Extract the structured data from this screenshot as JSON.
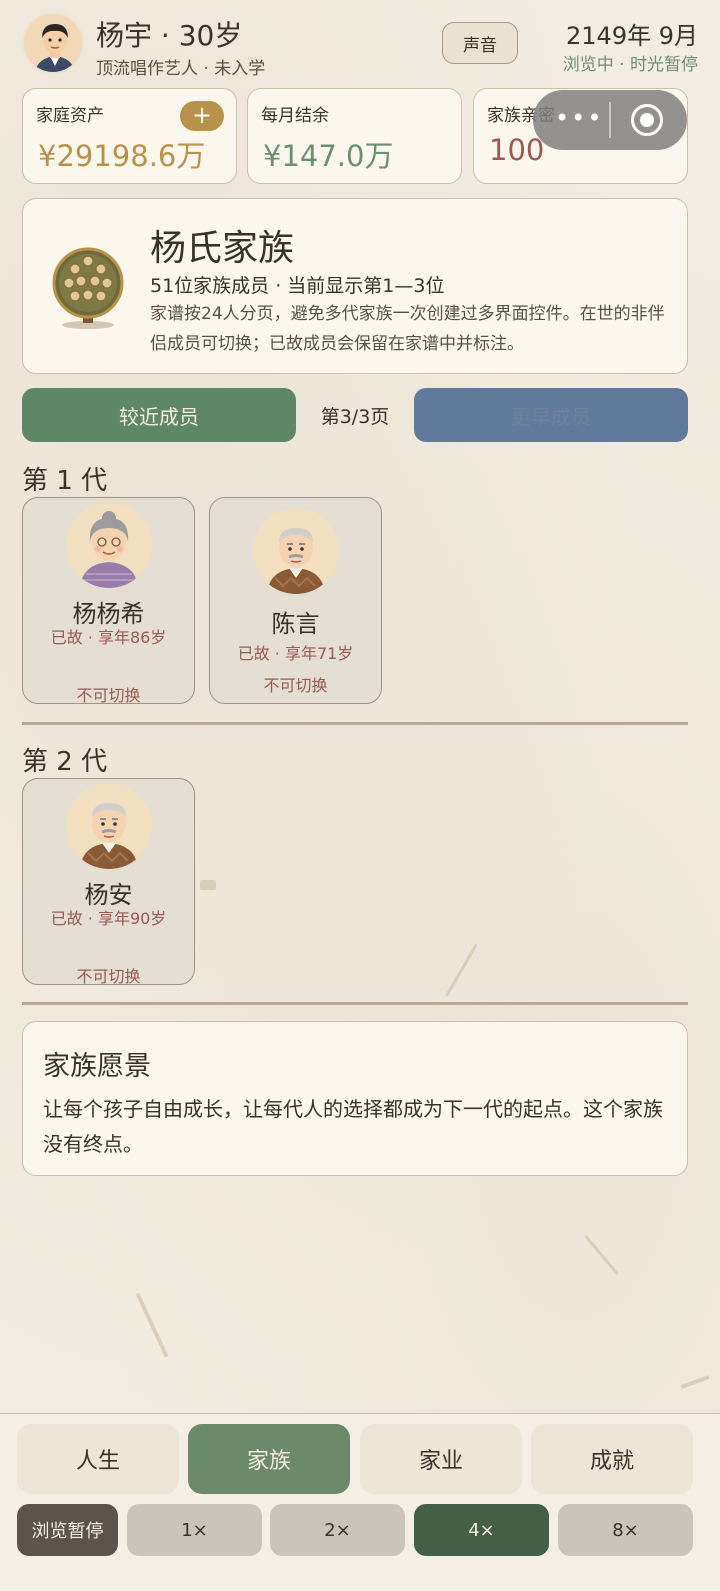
{
  "header": {
    "name": "杨宇 · 30岁",
    "subtitle": "顶流唱作艺人 · 未入学",
    "sound_label": "声音",
    "date": "2149年 9月",
    "status": "浏览中 · 时光暂停"
  },
  "stats": [
    {
      "label": "家庭资产",
      "value": "¥29198.6万",
      "color": "#b8914a",
      "action": "+"
    },
    {
      "label": "每月结余",
      "value": "¥147.0万",
      "color": "#6e8f6d"
    },
    {
      "label": "家族亲密",
      "value": "100",
      "color": "#9a5a4f"
    }
  ],
  "capsule": {
    "more": "•••"
  },
  "family": {
    "title": "杨氏家族",
    "subtitle": "51位家族成员 · 当前显示第1—3位",
    "description": "家谱按24人分页，避免多代家族一次创建过多界面控件。在世的非伴侣成员可切换；已故成员会保留在家谱中并标注。"
  },
  "pager": {
    "prev_label": "较近成员",
    "page_indicator": "第3/3页",
    "next_label": "更早成员"
  },
  "generations": [
    {
      "title": "第 1 代",
      "members": [
        {
          "name": "杨杨希",
          "status": "已故 · 享年86岁",
          "switchable": "不可切换",
          "avatar": "grandma-icon"
        },
        {
          "name": "陈言",
          "status": "已故 · 享年71岁",
          "switchable": "不可切换",
          "avatar": "grandpa-icon"
        }
      ]
    },
    {
      "title": "第 2 代",
      "members": [
        {
          "name": "杨安",
          "status": "已故 · 享年90岁",
          "switchable": "不可切换",
          "avatar": "grandpa-icon"
        }
      ]
    }
  ],
  "vision": {
    "title": "家族愿景",
    "text": "让每个孩子自由成长，让每代人的选择都成为下一代的起点。这个家族没有终点。"
  },
  "tabs": [
    {
      "label": "人生",
      "active": false
    },
    {
      "label": "家族",
      "active": true
    },
    {
      "label": "家业",
      "active": false
    },
    {
      "label": "成就",
      "active": false
    }
  ],
  "speeds": {
    "pause_label": "浏览暂停",
    "options": [
      {
        "label": "1×",
        "active": false
      },
      {
        "label": "2×",
        "active": false
      },
      {
        "label": "4×",
        "active": true
      },
      {
        "label": "8×",
        "active": false
      }
    ]
  }
}
